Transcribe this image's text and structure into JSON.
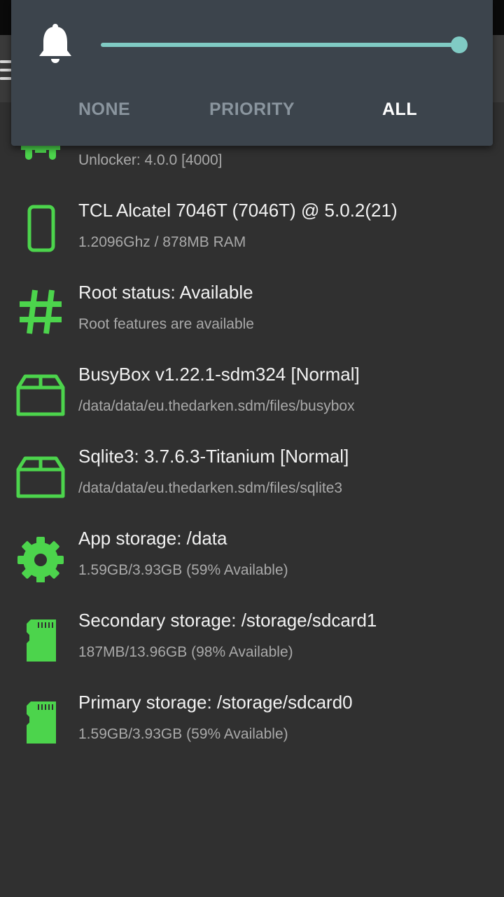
{
  "volume_panel": {
    "bell_icon": "bell-icon",
    "slider_percent": 100,
    "modes": [
      {
        "label": "NONE",
        "active": false
      },
      {
        "label": "PRIORITY",
        "active": false
      },
      {
        "label": "ALL",
        "active": true
      }
    ]
  },
  "items": [
    {
      "icon": "android-icon",
      "title": "",
      "subtitle": "Unlocker: 4.0.0 [4000]"
    },
    {
      "icon": "phone-icon",
      "title": "TCL Alcatel 7046T (7046T) @ 5.0.2(21)",
      "subtitle": "1.2096Ghz / 878MB RAM"
    },
    {
      "icon": "hash-icon",
      "title": "Root status: Available",
      "subtitle": "Root features are available"
    },
    {
      "icon": "box-icon",
      "title": "BusyBox v1.22.1-sdm324 [Normal]",
      "subtitle": "/data/data/eu.thedarken.sdm/files/busybox"
    },
    {
      "icon": "box-icon",
      "title": "Sqlite3: 3.7.6.3-Titanium [Normal]",
      "subtitle": "/data/data/eu.thedarken.sdm/files/sqlite3"
    },
    {
      "icon": "gear-icon",
      "title": "App storage: /data",
      "subtitle": "1.59GB/3.93GB (59% Available)"
    },
    {
      "icon": "sdcard-icon",
      "title": "Secondary storage: /storage/sdcard1",
      "subtitle": "187MB/13.96GB (98% Available)"
    },
    {
      "icon": "sdcard-icon",
      "title": "Primary storage: /storage/sdcard0",
      "subtitle": "1.59GB/3.93GB (59% Available)"
    }
  ],
  "colors": {
    "accent": "#4cd44c",
    "slider": "#80cbc4",
    "background": "#303030",
    "panel": "#3c444c"
  }
}
